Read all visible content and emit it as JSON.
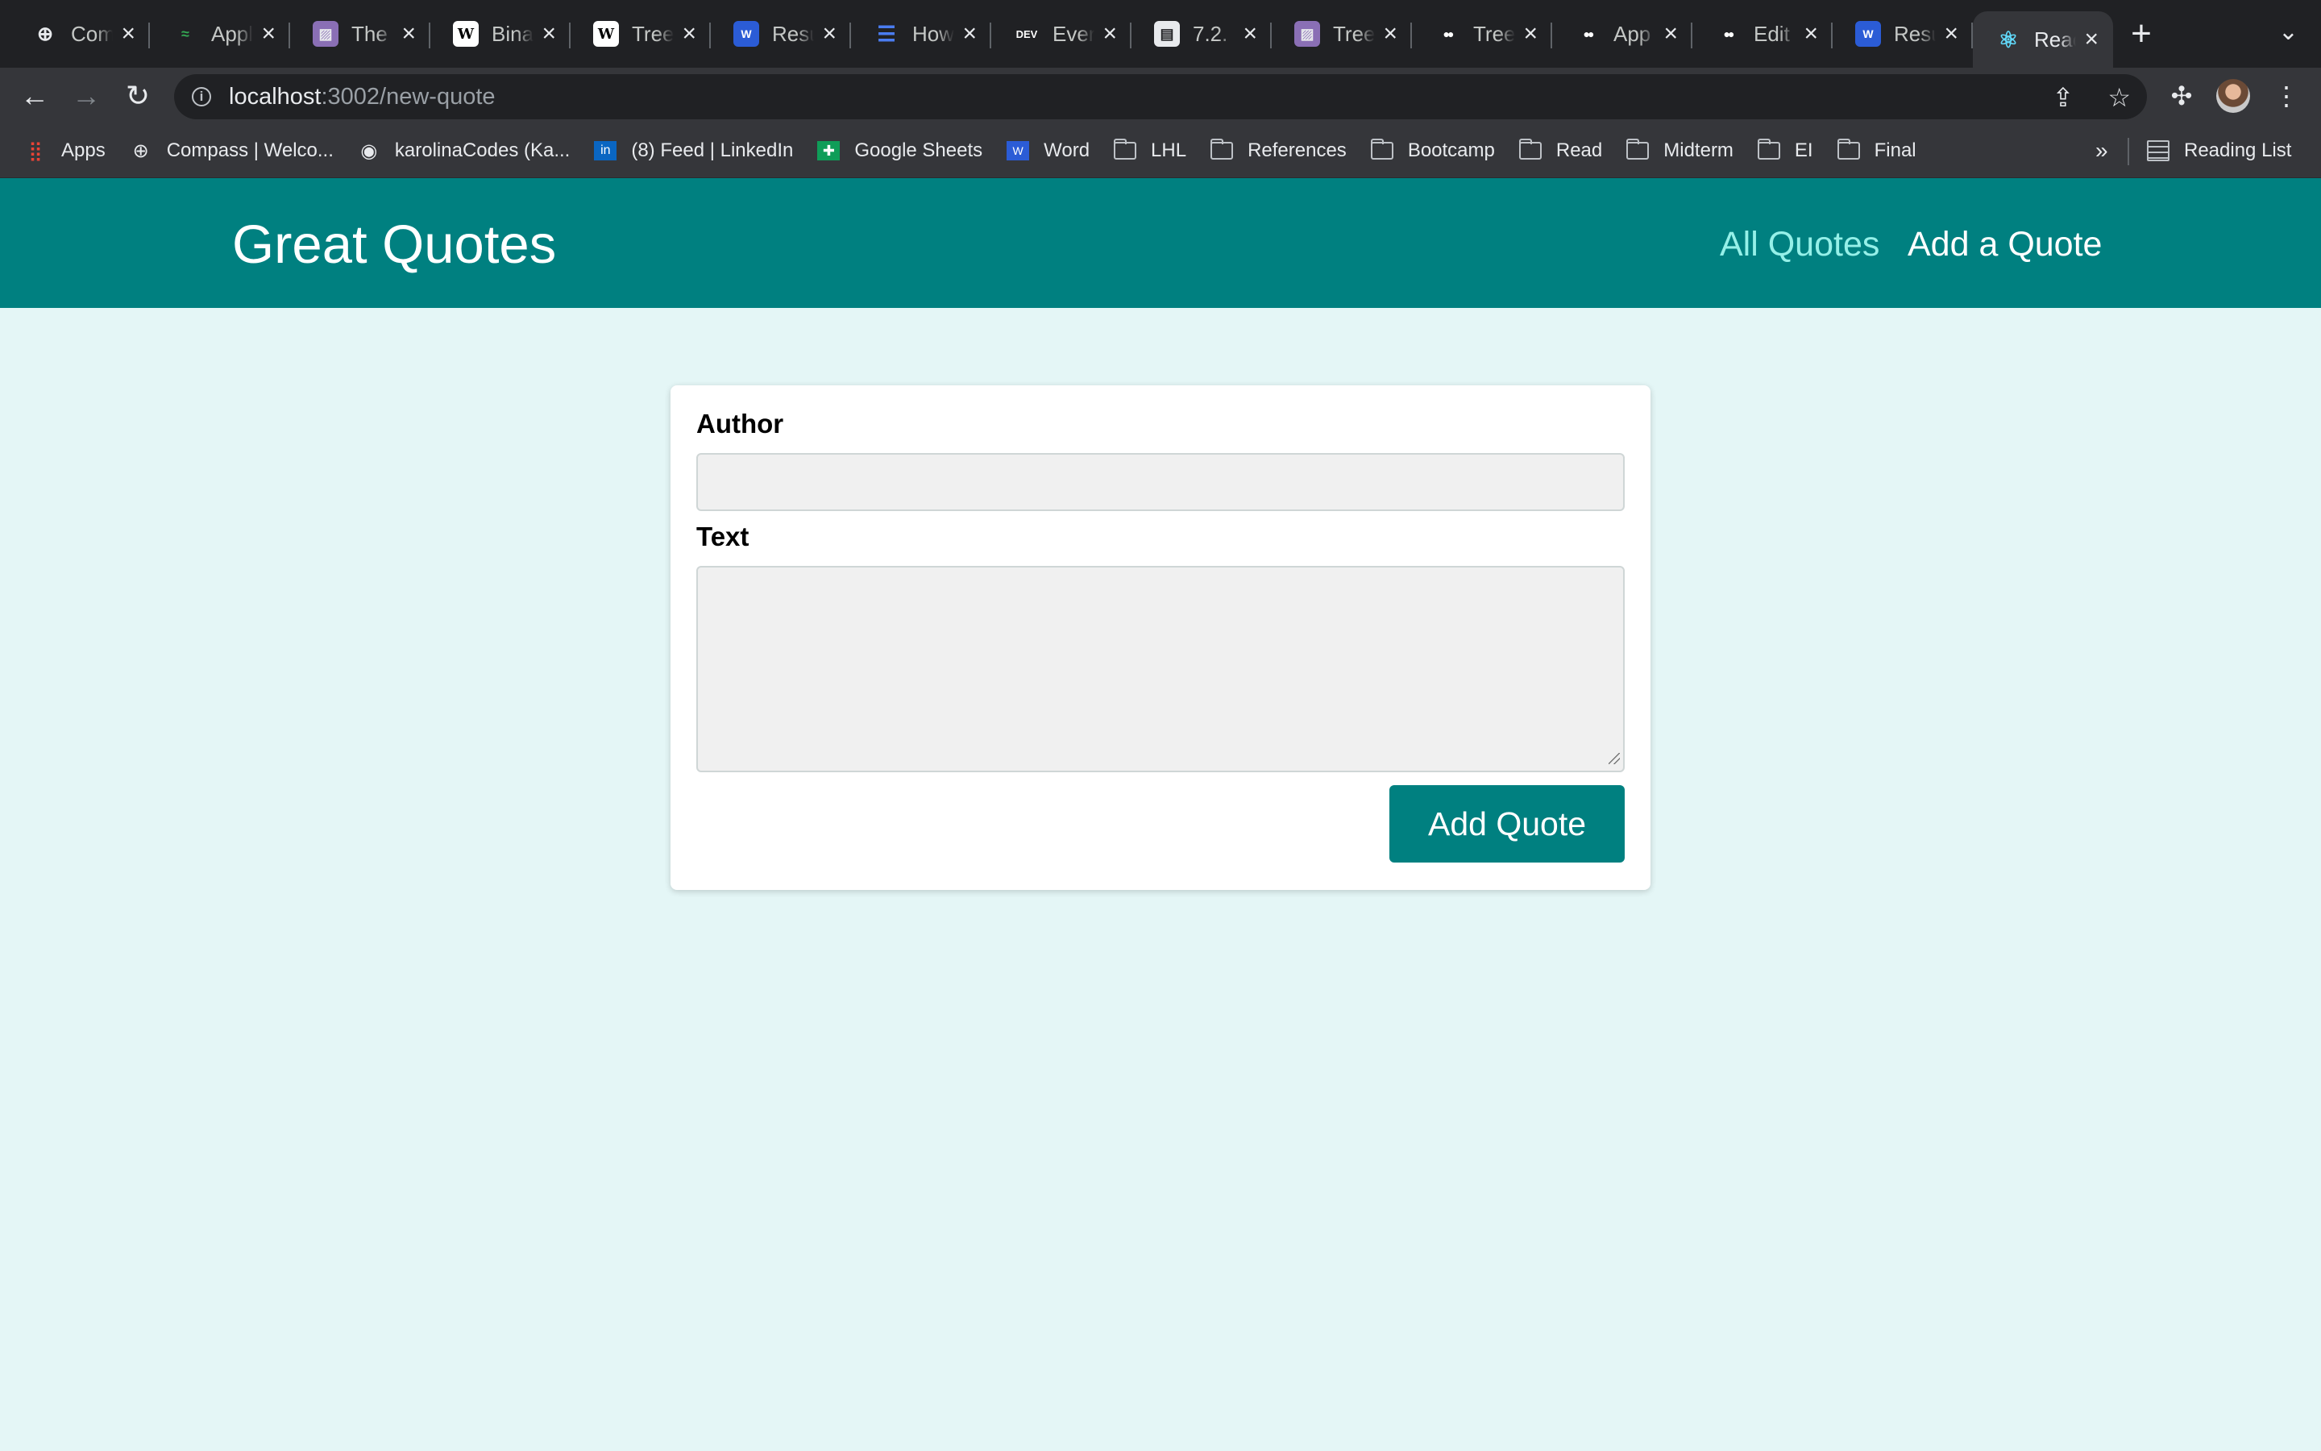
{
  "browser": {
    "tabs": [
      {
        "title": "Com",
        "icon": "compass-icon"
      },
      {
        "title": "Appl",
        "icon": "leaf-icon"
      },
      {
        "title": "The",
        "icon": "image-icon"
      },
      {
        "title": "Bina",
        "icon": "wikipedia-icon"
      },
      {
        "title": "Tree",
        "icon": "wikipedia-icon"
      },
      {
        "title": "Resu",
        "icon": "word-icon"
      },
      {
        "title": "How",
        "icon": "list-icon"
      },
      {
        "title": "Ever",
        "icon": "dev-icon"
      },
      {
        "title": "7.2.",
        "icon": "doc-icon"
      },
      {
        "title": "Tree",
        "icon": "image-icon"
      },
      {
        "title": "Tree",
        "icon": "medium-icon"
      },
      {
        "title": "App",
        "icon": "medium-icon"
      },
      {
        "title": "Edit",
        "icon": "medium-icon"
      },
      {
        "title": "Resu",
        "icon": "word-icon"
      },
      {
        "title": "Reac",
        "icon": "react-icon",
        "active": true
      }
    ],
    "url_host": "localhost",
    "url_path": ":3002/new-quote",
    "bookmarks": [
      {
        "label": "Apps",
        "icon": "apps-grid-icon"
      },
      {
        "label": "Compass | Welco...",
        "icon": "compass-icon"
      },
      {
        "label": "karolinaCodes (Ka...",
        "icon": "github-icon"
      },
      {
        "label": "(8) Feed | LinkedIn",
        "icon": "linkedin-icon"
      },
      {
        "label": "Google Sheets",
        "icon": "sheets-icon"
      },
      {
        "label": "Word",
        "icon": "word-icon"
      },
      {
        "label": "LHL",
        "icon": "folder-icon"
      },
      {
        "label": "References",
        "icon": "folder-icon"
      },
      {
        "label": "Bootcamp",
        "icon": "folder-icon"
      },
      {
        "label": "Read",
        "icon": "folder-icon"
      },
      {
        "label": "Midterm",
        "icon": "folder-icon"
      },
      {
        "label": "EI",
        "icon": "folder-icon"
      },
      {
        "label": "Final",
        "icon": "folder-icon"
      }
    ],
    "bookmarks_more": "»",
    "reading_list": "Reading List"
  },
  "app": {
    "brand": "Great Quotes",
    "nav": {
      "all_quotes": "All Quotes",
      "add_quote": "Add a Quote"
    },
    "form": {
      "author_label": "Author",
      "author_value": "",
      "text_label": "Text",
      "text_value": "",
      "submit_label": "Add Quote"
    }
  },
  "colors": {
    "header": "#008080",
    "page_bg": "#e4f6f6",
    "nav_active": "#95f0e8",
    "button": "#008080"
  }
}
